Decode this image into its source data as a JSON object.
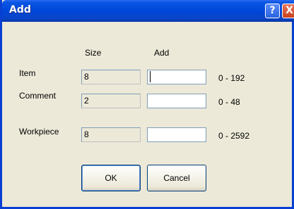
{
  "window": {
    "title": "Add",
    "help_label": "?",
    "close_label": "X"
  },
  "columns": {
    "size": "Size",
    "add": "Add"
  },
  "rows": [
    {
      "label": "Item",
      "size": "8",
      "add_value": "",
      "range": "0 - 192"
    },
    {
      "label": "Comment",
      "size": "2",
      "add_value": "",
      "range": "0 - 48"
    },
    {
      "label": "Workpiece",
      "size": "8",
      "add_value": "",
      "range": "0 - 2592"
    }
  ],
  "buttons": {
    "ok": "OK",
    "cancel": "Cancel"
  }
}
